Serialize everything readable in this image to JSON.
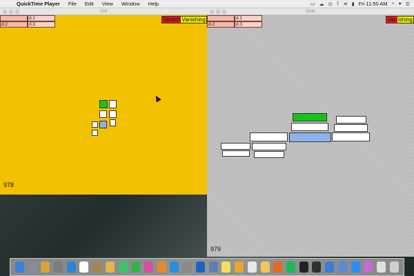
{
  "menubar": {
    "apple_glyph": "",
    "app_name": "QuickTime Player",
    "items": [
      "File",
      "Edit",
      "View",
      "Window",
      "Help"
    ],
    "clock": "Fri 11:50 AM",
    "status_icons": [
      "display-icon",
      "cloud-icon",
      "timemachine-icon",
      "bluetooth-icon",
      "wifi-icon",
      "battery-icon",
      "search-icon",
      "user-icon",
      "list-icon"
    ]
  },
  "left_window": {
    "title": "Ctrl",
    "cells": [
      {
        "text": "",
        "hdr": true
      },
      {
        "text": "d.1",
        "hdr": false
      },
      {
        "text": "d.2",
        "hdr": true
      },
      {
        "text": "d.3",
        "hdr": false
      }
    ],
    "badge_red": "Stretch",
    "badge_yellow": "Vanishing",
    "counter": "978"
  },
  "right_window": {
    "title": "Dots",
    "cells": [
      {
        "text": "",
        "hdr": true
      },
      {
        "text": "d.1",
        "hdr": false
      },
      {
        "text": "d.2",
        "hdr": true
      },
      {
        "text": "d.3",
        "hdr": false
      }
    ],
    "badge_red": "Van",
    "badge_yellow": "ishing",
    "counter": "979"
  },
  "colors": {
    "left_bg": "#f2c200",
    "right_bg": "#bdbdbd",
    "green": "#18c41b",
    "blue": "#8fb1ec",
    "red": "#e21b1b",
    "yellow": "#f7f200"
  },
  "dock": {
    "icons": [
      {
        "name": "finder-icon",
        "color": "#3a82e0"
      },
      {
        "name": "launchpad-icon",
        "color": "#8a8a9a"
      },
      {
        "name": "chrome-icon",
        "color": "#d9a33b"
      },
      {
        "name": "rocket-icon",
        "color": "#7d7d7d"
      },
      {
        "name": "safari-icon",
        "color": "#2b86d6"
      },
      {
        "name": "calendar-icon",
        "color": "#ffffff"
      },
      {
        "name": "contacts-icon",
        "color": "#a98253"
      },
      {
        "name": "photos-icon",
        "color": "#e6b64a"
      },
      {
        "name": "messages-icon",
        "color": "#39c46b"
      },
      {
        "name": "facetime-icon",
        "color": "#39b04b"
      },
      {
        "name": "itunes-icon",
        "color": "#d64fa3"
      },
      {
        "name": "ibooks-icon",
        "color": "#e8882b"
      },
      {
        "name": "appstore-icon",
        "color": "#2a8cdc"
      },
      {
        "name": "preferences-icon",
        "color": "#8a8a8a"
      },
      {
        "name": "teamviewer-icon",
        "color": "#1b64c4"
      },
      {
        "name": "preview-icon",
        "color": "#5b7fb0"
      },
      {
        "name": "notes-icon",
        "color": "#f5df5a"
      },
      {
        "name": "sketch-icon",
        "color": "#f0a42a"
      },
      {
        "name": "textedit-icon",
        "color": "#e8e8e8"
      },
      {
        "name": "pages-icon",
        "color": "#f2c55b"
      },
      {
        "name": "firefox-icon",
        "color": "#e56a22"
      },
      {
        "name": "spotify-icon",
        "color": "#1db954"
      },
      {
        "name": "terminal-icon",
        "color": "#222222"
      },
      {
        "name": "activity-icon",
        "color": "#303030"
      },
      {
        "name": "xcode-icon",
        "color": "#3b7bd2"
      },
      {
        "name": "finder2-icon",
        "color": "#5a8bd3"
      },
      {
        "name": "zoom-icon",
        "color": "#2d8cff"
      },
      {
        "name": "colorsync-icon",
        "color": "#c86ad3"
      },
      {
        "name": "folder-icon",
        "color": "#e0e0e0"
      },
      {
        "name": "trash-icon",
        "color": "#cfcfcf"
      }
    ]
  }
}
